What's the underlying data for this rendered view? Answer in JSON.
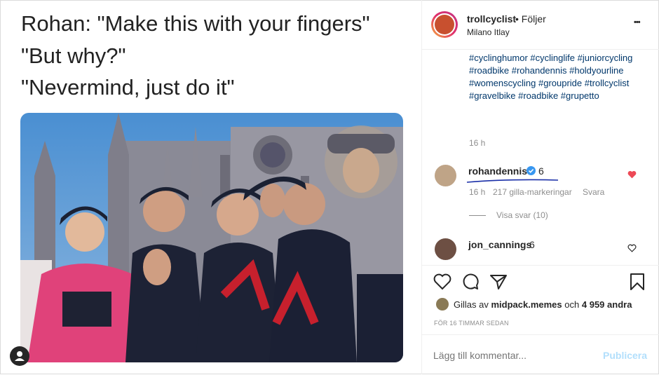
{
  "post_caption": [
    "Rohan: \"Make this with your fingers\"",
    "\"But why?\"",
    "\"Nevermind, just do it\""
  ],
  "header": {
    "username": "trollcyclist",
    "dot_follow": "• Följer",
    "location": "Milano Itlay",
    "more": "•••"
  },
  "hashtags": "#cyclinghumor #cyclinglife #juniorcycling #roadbike #rohandennis #holdyourline #womenscycling #groupride #trollcyclist #gravelbike #roadbike #grupetto",
  "caption_time": "16 h",
  "comments": [
    {
      "username": "rohandennis",
      "verified": true,
      "text": "6",
      "time": "16 h",
      "likes": "217 gilla-markeringar",
      "reply": "Svara",
      "view_replies": "Visa svar (10)",
      "liked": true
    },
    {
      "username": "jon_cannings",
      "text": "6"
    }
  ],
  "likes_line": {
    "prefix": "Gillas av",
    "user": "midpack.memes",
    "connector": "och",
    "count": "4 959 andra"
  },
  "post_age": "FÖR 16 TIMMAR SEDAN",
  "comment_input": {
    "placeholder": "Lägg till kommentar...",
    "publish": "Publicera"
  },
  "colors": {
    "link": "#00376b",
    "like_red": "#ed4956",
    "publish_disabled": "#b2dffc",
    "verified": "#3897f0",
    "jersey_pink": "#e0427a"
  },
  "icons": [
    "heart-icon",
    "comment-icon",
    "share-icon",
    "bookmark-icon",
    "verified-icon",
    "more-icon"
  ]
}
